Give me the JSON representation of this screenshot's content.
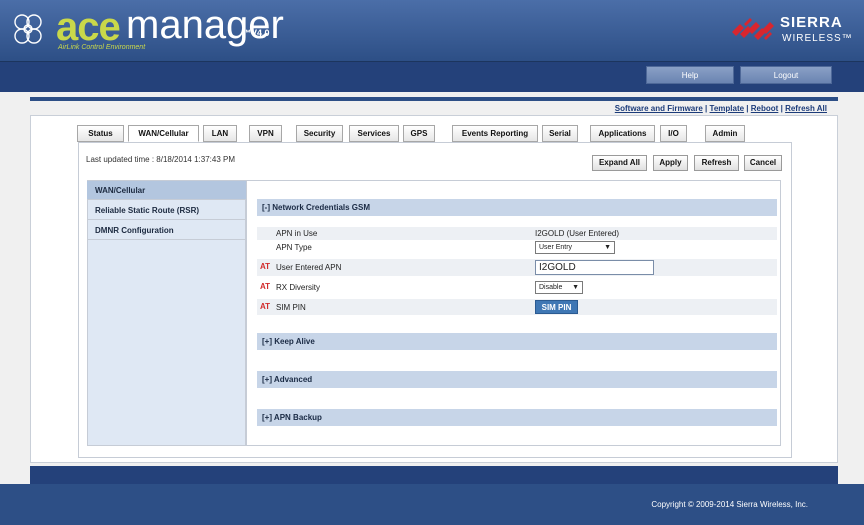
{
  "brand": {
    "ace": "ace",
    "manager": "manager",
    "tm": "™",
    "version": "V4.0",
    "tagline": "AirLink Control Environment",
    "vendor_name": "SIERRA",
    "vendor_sub": "WIRELESS™"
  },
  "topbar": {
    "help": "Help",
    "logout": "Logout"
  },
  "links": {
    "software": "Software and Firmware",
    "template": "Template",
    "reboot": "Reboot",
    "refresh_all": "Refresh All",
    "sep": "|"
  },
  "tabs": [
    {
      "label": "Status"
    },
    {
      "label": "WAN/Cellular"
    },
    {
      "label": "LAN"
    },
    {
      "label": "VPN"
    },
    {
      "label": "Security"
    },
    {
      "label": "Services"
    },
    {
      "label": "GPS"
    },
    {
      "label": "Events Reporting"
    },
    {
      "label": "Serial"
    },
    {
      "label": "Applications"
    },
    {
      "label": "I/O"
    },
    {
      "label": "Admin"
    }
  ],
  "toolbar": {
    "last_updated": "Last updated time : 8/18/2014 1:37:43 PM",
    "expand_all": "Expand All",
    "apply": "Apply",
    "refresh": "Refresh",
    "cancel": "Cancel"
  },
  "sidebar": {
    "items": [
      {
        "label": "WAN/Cellular"
      },
      {
        "label": "Reliable Static Route (RSR)"
      },
      {
        "label": "DMNR Configuration"
      }
    ]
  },
  "sections": {
    "network": "[-] Network Credentials GSM",
    "keep_alive": "[+] Keep Alive",
    "advanced": "[+] Advanced",
    "apn_backup": "[+] APN Backup"
  },
  "fields": {
    "apn_in_use_label": "APN in Use",
    "apn_in_use_value": "I2GOLD (User Entered)",
    "apn_type_label": "APN Type",
    "apn_type_value": "User Entry",
    "user_apn_label": "User Entered APN",
    "user_apn_value": "I2GOLD",
    "rx_label": "RX Diversity",
    "rx_value": "Disable",
    "sim_label": "SIM PIN",
    "sim_button": "SIM PIN",
    "at": "AT"
  },
  "footer": {
    "copyright": "Copyright © 2009-2014 Sierra Wireless, Inc."
  },
  "colors": {
    "header": "#2d4f86",
    "accent_green": "#c9d84a",
    "vendor_red": "#d8262e",
    "section_bg": "#c7d5e8"
  }
}
